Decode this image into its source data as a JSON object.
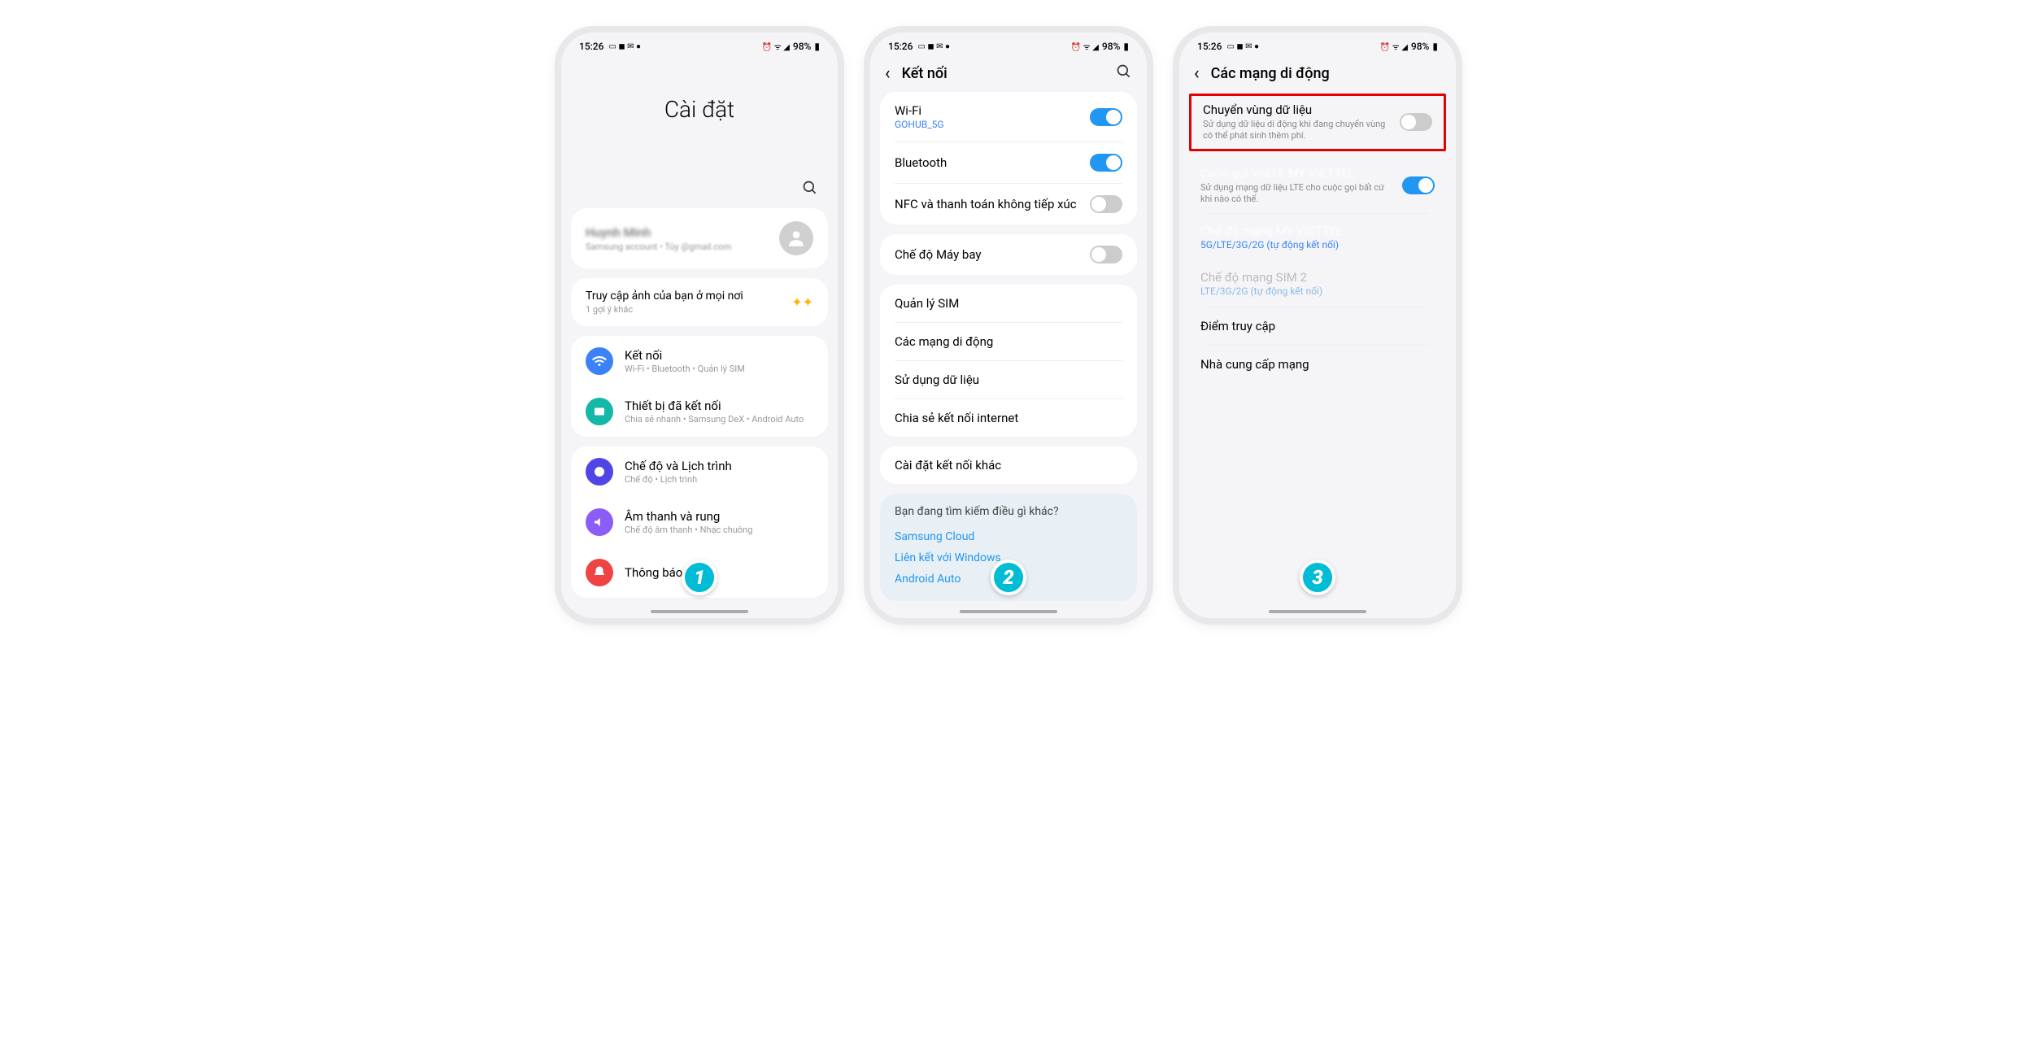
{
  "status": {
    "time": "15:26",
    "battery": "98%"
  },
  "screen1": {
    "title": "Cài đặt",
    "account": {
      "name": "Huynh Minh",
      "sub": "Samsung account • Tủy",
      "email": "@gmail.com"
    },
    "suggestion": {
      "title": "Truy cập ảnh của bạn ở mọi nơi",
      "sub": "1 gợi ý khác"
    },
    "items": [
      {
        "title": "Kết nối",
        "sub": "Wi-Fi • Bluetooth • Quản lý SIM"
      },
      {
        "title": "Thiết bị đã kết nối",
        "sub": "Chia sẻ nhanh • Samsung DeX • Android Auto"
      },
      {
        "title": "Chế độ và Lịch trình",
        "sub": "Chế độ • Lịch trình"
      },
      {
        "title": "Âm thanh và rung",
        "sub": "Chế độ âm thanh • Nhạc chuông"
      },
      {
        "title": "Thông báo",
        "sub": ""
      }
    ]
  },
  "screen2": {
    "title": "Kết nối",
    "wifi": {
      "title": "Wi-Fi",
      "sub": "GOHUB_5G"
    },
    "bluetooth": {
      "title": "Bluetooth"
    },
    "nfc": {
      "title": "NFC và thanh toán không tiếp xúc"
    },
    "airplane": {
      "title": "Chế độ Máy bay"
    },
    "rows": [
      "Quản lý SIM",
      "Các mạng di động",
      "Sử dụng dữ liệu",
      "Chia sẻ kết nối internet",
      "Cài đặt kết nối khác"
    ],
    "other": {
      "title": "Bạn đang tìm kiếm điều gì khác?",
      "links": [
        "Samsung Cloud",
        "Liên kết với Windows",
        "Android Auto"
      ]
    }
  },
  "screen3": {
    "title": "Các mạng di động",
    "roaming": {
      "title": "Chuyển vùng dữ liệu",
      "desc": "Sử dụng dữ liệu di động khi đang chuyển vùng có thể phát sinh thêm phí."
    },
    "volte": {
      "title": "Cuộc gọi VoLTE MY VIETTEL",
      "desc": "Sử dụng mạng dữ liệu LTE cho cuộc gọi bất cứ khi nào có thể."
    },
    "mode1": {
      "title": "Chế độ mạng MY VIETTEL",
      "sub": "5G/LTE/3G/2G (tự động kết nối)"
    },
    "mode2": {
      "title": "Chế độ mạng SIM 2",
      "sub": "LTE/3G/2G (tự động kết nối)"
    },
    "apn": "Điểm truy cập",
    "carrier": "Nhà cung cấp mạng"
  },
  "badges": [
    "1",
    "2",
    "3"
  ]
}
